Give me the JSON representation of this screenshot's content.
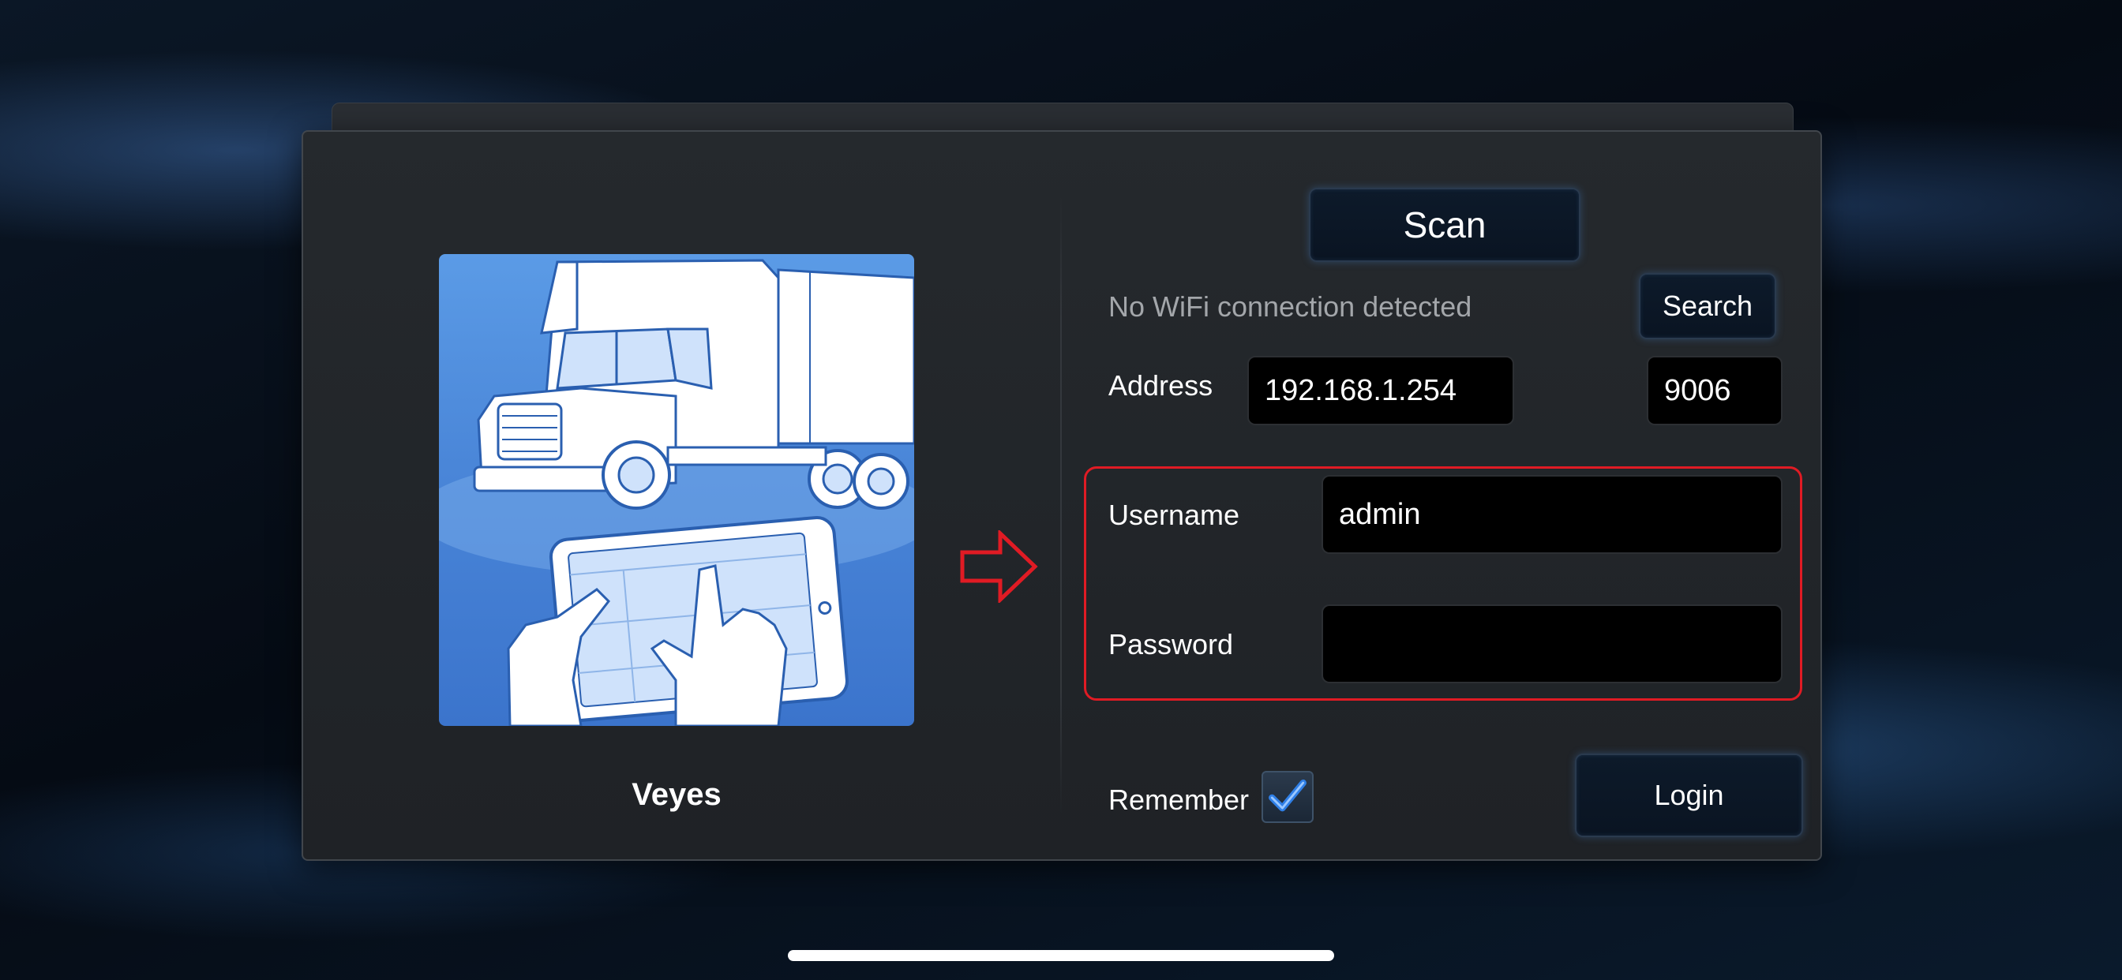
{
  "app": {
    "name": "Veyes",
    "image_icon": "truck-tablet-illustration-icon"
  },
  "connection": {
    "scan_label": "Scan",
    "status_text": "No WiFi connection detected",
    "search_label": "Search",
    "address_label": "Address",
    "address_value": "192.168.1.254",
    "port_value": "9006"
  },
  "credentials": {
    "username_label": "Username",
    "username_value": "admin",
    "password_label": "Password",
    "password_value": ""
  },
  "footer": {
    "remember_label": "Remember",
    "remember_checked": true,
    "login_label": "Login"
  },
  "colors": {
    "highlight": "#e01b24",
    "arrow": "#e01b24",
    "checkmark": "#2f7fe6"
  }
}
